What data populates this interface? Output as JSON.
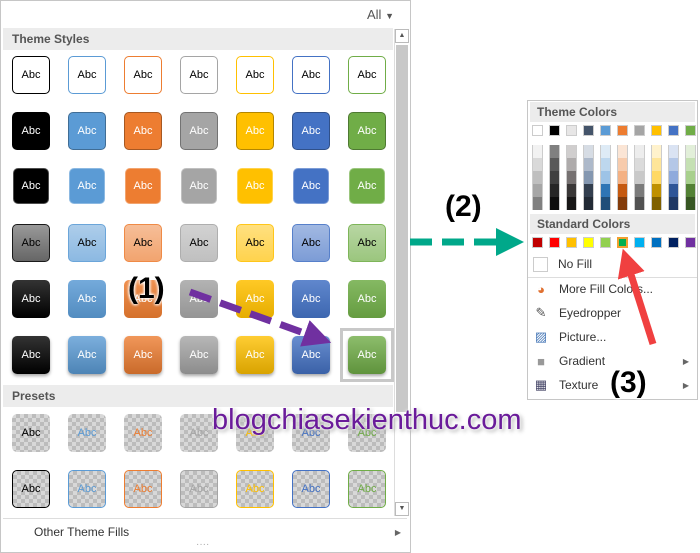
{
  "left_panel": {
    "filter": "All",
    "filter_icon": "caret-down-icon",
    "theme_styles_header": "Theme Styles",
    "presets_header": "Presets",
    "tile_label": "Abc",
    "other_fills": "Other Theme Fills",
    "other_fills_icon": "chevron-right-icon",
    "resize_grip": "····",
    "theme_colors": [
      "#000000",
      "#5b9bd5",
      "#ed7d31",
      "#a5a5a5",
      "#ffc000",
      "#4472c4",
      "#70ad47"
    ],
    "style_rows": [
      "outline",
      "solid",
      "solid-light-border",
      "light",
      "intense",
      "moderate-shadow"
    ],
    "preset_rows": [
      "transparent",
      "transparent-outline"
    ],
    "selected": {
      "row": 6,
      "col": 7
    }
  },
  "menu": {
    "theme_colors_header": "Theme Colors",
    "theme_top": [
      "#ffffff",
      "#000000",
      "#e7e6e6",
      "#44546a",
      "#5b9bd5",
      "#ed7d31",
      "#a5a5a5",
      "#ffc000",
      "#4472c4",
      "#70ad47"
    ],
    "theme_shades": [
      [
        "#f2f2f2",
        "#d9d9d9",
        "#bfbfbf",
        "#a6a6a6",
        "#808080"
      ],
      [
        "#808080",
        "#595959",
        "#404040",
        "#262626",
        "#0d0d0d"
      ],
      [
        "#d0cece",
        "#aeabab",
        "#767171",
        "#3a3838",
        "#171616"
      ],
      [
        "#d6dce4",
        "#adb9ca",
        "#8497b0",
        "#333f4f",
        "#222a35"
      ],
      [
        "#deebf6",
        "#bdd7ee",
        "#9dc3e6",
        "#2e75b5",
        "#1f4e79"
      ],
      [
        "#fbe5d5",
        "#f7cbac",
        "#f4b183",
        "#c55a11",
        "#833c0b"
      ],
      [
        "#ededed",
        "#dbdbdb",
        "#c9c9c9",
        "#7b7b7b",
        "#525252"
      ],
      [
        "#fff2cc",
        "#fee599",
        "#ffd965",
        "#bf9000",
        "#7f6000"
      ],
      [
        "#dae3f3",
        "#b4c7e7",
        "#8faadc",
        "#2f5597",
        "#203864"
      ],
      [
        "#e2efd9",
        "#c5e0b3",
        "#a8d08d",
        "#538135",
        "#375623"
      ]
    ],
    "standard_colors_header": "Standard Colors",
    "standard": [
      "#c00000",
      "#ff0000",
      "#ffc000",
      "#ffff00",
      "#92d050",
      "#00b050",
      "#00b0f0",
      "#0070c0",
      "#002060",
      "#7030a0"
    ],
    "selected_standard": 5,
    "no_fill": "No Fill",
    "items": [
      {
        "label": "More Fill Colors...",
        "icon": "color-wheel-icon"
      },
      {
        "label": "Eyedropper",
        "icon": "eyedropper-icon"
      },
      {
        "label": "Picture...",
        "icon": "picture-icon"
      },
      {
        "label": "Gradient",
        "icon": "gradient-icon",
        "submenu": true
      },
      {
        "label": "Texture",
        "icon": "texture-icon",
        "submenu": true
      }
    ]
  },
  "annotations": {
    "step1": "(1)",
    "step2": "(2)",
    "step3": "(3)",
    "arrow1_color": "#7030a0",
    "arrow2_color": "#00a88a",
    "arrow3_color": "#f04040"
  },
  "watermark": "blogchiasekienthuc.com"
}
